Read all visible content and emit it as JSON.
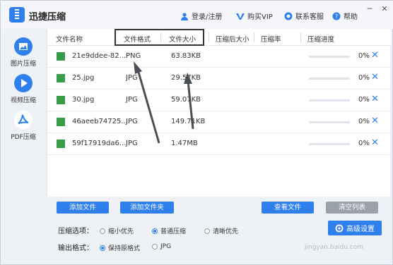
{
  "app": {
    "title": "迅捷压缩"
  },
  "header": {
    "login": "登录/注册",
    "vip": "购买VIP",
    "support": "联系客服",
    "help": "帮助"
  },
  "window_controls": {
    "minimize": "─",
    "close": "✕"
  },
  "sidebar": {
    "items": [
      {
        "label": "图片压缩",
        "icon": "image-icon"
      },
      {
        "label": "视频压缩",
        "icon": "play-icon"
      },
      {
        "label": "PDF压缩",
        "icon": "pdf-icon"
      }
    ]
  },
  "table": {
    "columns": {
      "name": "文件名称",
      "format": "文件格式",
      "size": "文件大小",
      "compressed_size": "压缩后大小",
      "ratio": "压缩率",
      "progress": "压缩进度"
    },
    "rows": [
      {
        "name": "21e9ddee-82...",
        "format": "PNG",
        "size": "63.83KB",
        "progress_pct": "0%",
        "progress_value": 0
      },
      {
        "name": "25.jpg",
        "format": "JPG",
        "size": "29.57KB",
        "progress_pct": "0%",
        "progress_value": 0
      },
      {
        "name": "30.jpg",
        "format": "JPG",
        "size": "59.07KB",
        "progress_pct": "0%",
        "progress_value": 0
      },
      {
        "name": "46aeeb74725...",
        "format": "JPG",
        "size": "149.71KB",
        "progress_pct": "0%",
        "progress_value": 0
      },
      {
        "name": "59f17919da6...",
        "format": "JPG",
        "size": "1.47MB",
        "progress_pct": "0%",
        "progress_value": 0
      }
    ]
  },
  "actions": {
    "add_file": "添加文件",
    "add_folder": "添加文件夹",
    "view_file": "查看文件",
    "clear_list": "清空列表"
  },
  "compress_options": {
    "label": "压缩选项：",
    "options": [
      "缩小优先",
      "普通压缩",
      "清晰优先"
    ],
    "selected": "普通压缩"
  },
  "output_format": {
    "label": "输出格式：",
    "options": [
      "保持原格式",
      "JPG"
    ],
    "selected": "保持原格式"
  },
  "advanced_settings": "高级设置",
  "watermark": "jingyan.baidu.com",
  "colors": {
    "accent": "#2f80ed",
    "image_icon": "#3a9b48",
    "disabled_button": "#9aa1ab"
  }
}
